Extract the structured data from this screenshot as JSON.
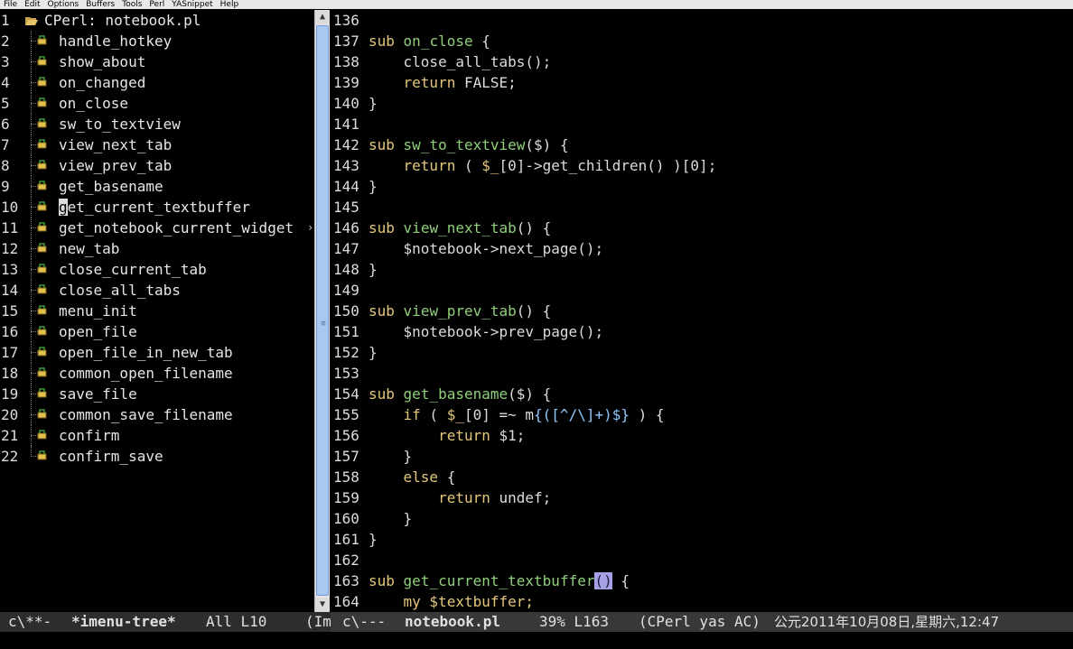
{
  "menubar": {
    "items": [
      "File",
      "Edit",
      "Options",
      "Buffers",
      "Tools",
      "Perl",
      "YASnippet",
      "Help"
    ]
  },
  "imenu_tree": {
    "root_label": "CPerl: notebook.pl",
    "line_numbers": [
      "1",
      "2",
      "3",
      "4",
      "5",
      "6",
      "7",
      "8",
      "9",
      "10",
      "11",
      "12",
      "13",
      "14",
      "15",
      "16",
      "17",
      "18",
      "19",
      "20",
      "21",
      "22"
    ],
    "items": [
      "handle_hotkey",
      "show_about",
      "on_changed",
      "on_close",
      "sw_to_textview",
      "view_next_tab",
      "view_prev_tab",
      "get_basename",
      "get_current_textbuffer",
      "get_notebook_current_widget",
      "new_tab",
      "close_current_tab",
      "close_all_tabs",
      "menu_init",
      "open_file",
      "open_file_in_new_tab",
      "common_open_filename",
      "save_file",
      "common_save_filename",
      "confirm",
      "confirm_save"
    ],
    "truncation_marker": "›"
  },
  "editor": {
    "lines": [
      {
        "n": "136"
      },
      {
        "n": "137"
      },
      {
        "n": "138"
      },
      {
        "n": "139"
      },
      {
        "n": "140"
      },
      {
        "n": "141"
      },
      {
        "n": "142"
      },
      {
        "n": "143"
      },
      {
        "n": "144"
      },
      {
        "n": "145"
      },
      {
        "n": "146"
      },
      {
        "n": "147"
      },
      {
        "n": "148"
      },
      {
        "n": "149"
      },
      {
        "n": "150"
      },
      {
        "n": "151"
      },
      {
        "n": "152"
      },
      {
        "n": "153"
      },
      {
        "n": "154"
      },
      {
        "n": "155"
      },
      {
        "n": "156"
      },
      {
        "n": "157"
      },
      {
        "n": "158"
      },
      {
        "n": "159"
      },
      {
        "n": "160"
      },
      {
        "n": "161"
      },
      {
        "n": "162"
      },
      {
        "n": "163"
      },
      {
        "n": "164"
      }
    ],
    "tokens": {
      "sub": "sub",
      "on_close": "on_close",
      "brace_open": " {",
      "brace_close": "}",
      "close_all_tabs_call": "    close_all_tabs();",
      "return_kw": "return",
      "false_val": " FALSE;",
      "sw_to_textview": "sw_to_textview",
      "proto_dollar": "($) {",
      "ret_children_1": " ( ",
      "ret_children_var": "$_",
      "ret_children_2": "[0]->get_children() )[0];",
      "view_next_tab": "view_next_tab",
      "empty_proto": "() {",
      "notebook_next": "    $notebook->next_page();",
      "view_prev_tab": "view_prev_tab",
      "notebook_prev": "    $notebook->prev_page();",
      "get_basename": "get_basename",
      "if_kw": "if",
      "if_mid_1": " ( ",
      "if_var": "$_",
      "if_mid_2": "[0] =~ m",
      "regex": "{([^/\\]+)$}",
      "if_tail": " ) {",
      "return_one": " $1;",
      "else_kw": "else",
      "undef_val": " undef;",
      "get_current_textbuffer": "get_current_textbuffer",
      "paren_pair": "()",
      "my_kw": "my",
      "textbuffer_var": " $textbuffer;"
    }
  },
  "modeline": {
    "left_state": "c\\**-",
    "left_buffer": "*imenu-tree*",
    "left_pos": "All L10",
    "left_mode_trunc": "(Im",
    "right_state": "c\\---",
    "right_buffer": "notebook.pl",
    "right_pos": "39% L163",
    "right_mode": "(CPerl yas AC)",
    "right_datetime": "公元2011年10月08日,星期六,12:47"
  },
  "colors": {
    "background": "#000000",
    "keyword": "#e3c77a",
    "function_name": "#8fcf7a",
    "regex": "#8fc8ff",
    "paren_highlight": "#a7a2e6",
    "modeline_bg": "#383838",
    "scrollbar_thumb": "#a9c8f0"
  },
  "icons": {
    "root": "folder-open-icon",
    "leaf": "function-node-icon",
    "scroll_up": "arrow-up-icon",
    "scroll_down": "arrow-down-icon"
  }
}
